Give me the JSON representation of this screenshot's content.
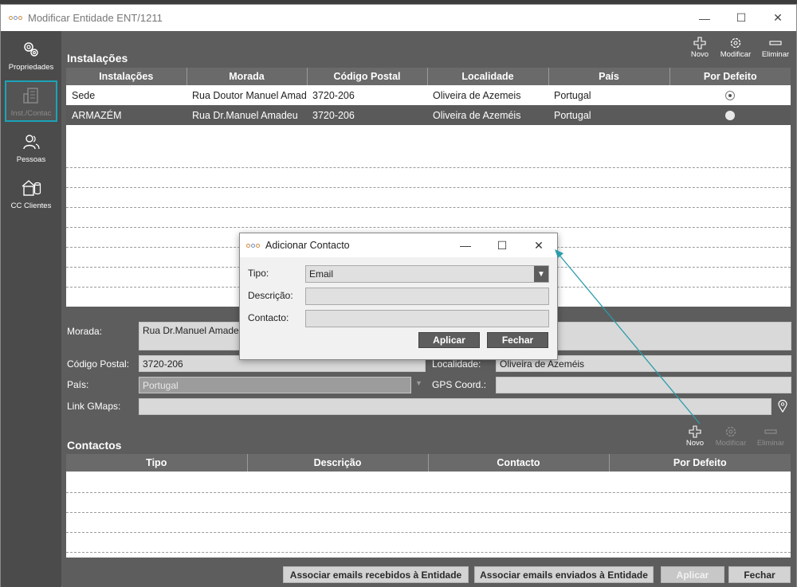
{
  "window": {
    "title": "Modificar Entidade ENT/1211",
    "controls": [
      "—",
      "☐",
      "✕"
    ]
  },
  "sidebar": {
    "items": [
      {
        "label": "Propriedades",
        "icon": "gears-icon"
      },
      {
        "label": "Inst./Contac",
        "icon": "building-icon"
      },
      {
        "label": "Pessoas",
        "icon": "people-icon"
      },
      {
        "label": "CC Clientes",
        "icon": "cc-clientes-icon"
      }
    ]
  },
  "instalacoes": {
    "title": "Instalações",
    "toolbar": {
      "novo": "Novo",
      "modificar": "Modificar",
      "eliminar": "Eliminar"
    },
    "columns": [
      "Instalações",
      "Morada",
      "Código Postal",
      "Localidade",
      "País",
      "Por Defeito"
    ],
    "rows": [
      {
        "instalacao": "Sede",
        "morada": "Rua Doutor Manuel Amadeu",
        "codigo_postal": "3720-206",
        "localidade": "Oliveira de Azemeis",
        "pais": "Portugal",
        "por_defeito": "selected"
      },
      {
        "instalacao": "ARMAZÉM",
        "morada": "Rua Dr.Manuel Amadeu",
        "codigo_postal": "3720-206",
        "localidade": "Oliveira de Azeméis",
        "pais": "Portugal",
        "por_defeito": "unselected"
      }
    ]
  },
  "details": {
    "morada_label": "Morada:",
    "morada_value": "Rua Dr.Manuel Amadeu",
    "codigo_postal_label": "Código Postal:",
    "codigo_postal_value": "3720-206",
    "localidade_label": "Localidade:",
    "localidade_value": "Oliveira de Azeméis",
    "pais_label": "País:",
    "pais_value": "Portugal",
    "gps_label": "GPS Coord.:",
    "gps_value": "",
    "link_label": "Link GMaps:",
    "link_value": ""
  },
  "contactos": {
    "title": "Contactos",
    "toolbar": {
      "novo": "Novo",
      "modificar": "Modificar",
      "eliminar": "Eliminar"
    },
    "columns": [
      "Tipo",
      "Descrição",
      "Contacto",
      "Por Defeito"
    ]
  },
  "footer": {
    "associar_recebidos": "Associar emails recebidos à Entidade",
    "associar_enviados": "Associar emails enviados à Entidade",
    "aplicar": "Aplicar",
    "fechar": "Fechar"
  },
  "dialog": {
    "title": "Adicionar Contacto",
    "tipo_label": "Tipo:",
    "tipo_value": "Email",
    "descricao_label": "Descrição:",
    "descricao_value": "",
    "contacto_label": "Contacto:",
    "contacto_value": "",
    "aplicar": "Aplicar",
    "fechar": "Fechar"
  },
  "colors": {
    "accent": "#1aa3b8",
    "panel": "#5d5d5d",
    "sidebar": "#4b4b4b",
    "selected_row": "#5a5a5a"
  }
}
